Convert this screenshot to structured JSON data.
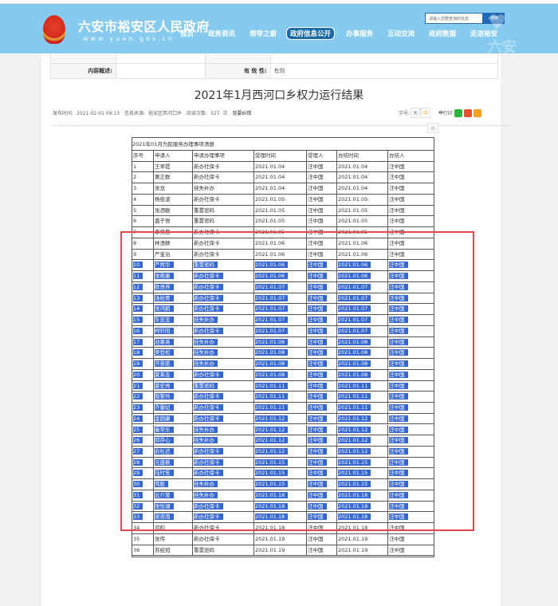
{
  "header": {
    "site_title": "六安市裕安区人民政府",
    "site_url": "www.yuan.gov.cn",
    "search_placeholder": "请输入您要查询的信息",
    "search_button": "搜索",
    "deco_text": "六安",
    "nav": [
      "首页",
      "政务资讯",
      "领导之窗",
      "政府信息公开",
      "办事服务",
      "互动交流",
      "政府数据",
      "走进裕安"
    ],
    "active_nav": 3
  },
  "meta": {
    "content_label": "内容概述:",
    "validity_label": "有 效 性:",
    "validity_value": "有效"
  },
  "article": {
    "title": "2021年1月西河口乡权力运行结果",
    "publish_label": "发布时间:",
    "publish_time": "2021-02-01 09:13",
    "source_label": "信息来源:",
    "source": "裕安区西河口乡",
    "views_label": "阅读次数:",
    "views": "327",
    "views_unit": "次",
    "correction": "我要纠错",
    "font_label": "字号:",
    "font_large": "大",
    "font_medium": "中",
    "font_small": "小",
    "print": "打印"
  },
  "table": {
    "caption": "2021年01月为民服务办理事项清册",
    "headers": [
      "序号",
      "申请人",
      "申请办理事项",
      "受理时间",
      "受理人",
      "办结时间",
      "办结人"
    ],
    "highlighted_rows": [
      10,
      33
    ],
    "rows": [
      [
        "1",
        "王翠提",
        "新办社保卡",
        "2021.01.04",
        "汪中国",
        "2021.01.04",
        "汪中国"
      ],
      [
        "2",
        "黄正群",
        "新办社保卡",
        "2021.01.04",
        "汪中国",
        "2021.01.04",
        "汪中国"
      ],
      [
        "3",
        "张龙",
        "挂失补办",
        "2021.01.04",
        "汪中国",
        "2021.01.04",
        "汪中国"
      ],
      [
        "4",
        "杨俊波",
        "新办社保卡",
        "2021.01.05",
        "汪中国",
        "2021.01.05",
        "汪中国"
      ],
      [
        "5",
        "张洒敏",
        "重置密码",
        "2021.01.05",
        "汪中国",
        "2021.01.05",
        "汪中国"
      ],
      [
        "6",
        "盛子悦",
        "重置密码",
        "2021.01.05",
        "汪中国",
        "2021.01.05",
        "汪中国"
      ],
      [
        "7",
        "李奕晨",
        "新办社保卡",
        "2021.01.05",
        "汪中国",
        "2021.01.05",
        "汪中国"
      ],
      [
        "8",
        "林澄静",
        "新办社保卡",
        "2021.01.06",
        "汪中国",
        "2021.01.06",
        "汪中国"
      ],
      [
        "9",
        "严宝治",
        "新办社保卡",
        "2021.01.06",
        "汪中国",
        "2021.01.06",
        "汪中国"
      ],
      [
        "10",
        "严席华",
        "重置密码",
        "2021.01.06",
        "汪中国",
        "2021.01.06",
        "汪中国"
      ],
      [
        "11",
        "张殿康",
        "新办社保卡",
        "2021.01.06",
        "汪中国",
        "2021.01.06",
        "汪中国"
      ],
      [
        "12",
        "欧贤界",
        "新办社保卡",
        "2021.01.07",
        "汪中国",
        "2021.01.07",
        "汪中国"
      ],
      [
        "13",
        "汤始青",
        "新办社保卡",
        "2021.01.07",
        "汪中国",
        "2021.01.07",
        "汪中国"
      ],
      [
        "14",
        "张鸿鹤",
        "新办社保卡",
        "2021.01.07",
        "汪中国",
        "2021.01.07",
        "汪中国"
      ],
      [
        "15",
        "车亚忠",
        "挂失补办",
        "2021.01.07",
        "汪中国",
        "2021.01.07",
        "汪中国"
      ],
      [
        "16",
        "柯轩阳",
        "新办社保卡",
        "2021.01.07",
        "汪中国",
        "2021.01.07",
        "汪中国"
      ],
      [
        "17",
        "池慕英",
        "挂失补办",
        "2021.01.08",
        "汪中国",
        "2021.01.08",
        "汪中国"
      ],
      [
        "18",
        "吴登松",
        "挂失补办",
        "2021.01.08",
        "汪中国",
        "2021.01.08",
        "汪中国"
      ],
      [
        "19",
        "齐奋愿",
        "挂失补办",
        "2021.01.08",
        "汪中国",
        "2021.01.08",
        "汪中国"
      ],
      [
        "20",
        "夏莱志",
        "新办社保卡",
        "2021.01.08",
        "汪中国",
        "2021.01.08",
        "汪中国"
      ],
      [
        "21",
        "夏史亮",
        "重置密码",
        "2021.01.11",
        "汪中国",
        "2021.01.11",
        "汪中国"
      ],
      [
        "22",
        "殷黎共",
        "新办社保卡",
        "2021.01.11",
        "汪中国",
        "2021.01.11",
        "汪中国"
      ],
      [
        "23",
        "齐馨妃",
        "新办社保卡",
        "2021.01.11",
        "汪中国",
        "2021.01.11",
        "汪中国"
      ],
      [
        "24",
        "金园康",
        "新办社保卡",
        "2021.01.12",
        "汪中国",
        "2021.01.12",
        "汪中国"
      ],
      [
        "25",
        "秦常乐",
        "挂失补办",
        "2021.01.12",
        "汪中国",
        "2021.01.12",
        "汪中国"
      ],
      [
        "26",
        "邱存心",
        "挂失补办",
        "2021.01.12",
        "汪中国",
        "2021.01.12",
        "汪中国"
      ],
      [
        "27",
        "俞杜迟",
        "新办社保卡",
        "2021.01.12",
        "汪中国",
        "2021.01.12",
        "汪中国"
      ],
      [
        "28",
        "元盛枫",
        "新办社保卡",
        "2021.01.15",
        "汪中国",
        "2021.01.15",
        "汪中国"
      ],
      [
        "29",
        "陆时笙",
        "新办社保卡",
        "2021.01.15",
        "汪中国",
        "2021.01.15",
        "汪中国"
      ],
      [
        "30",
        "简胜",
        "挂失补办",
        "2021.01.15",
        "汪中国",
        "2021.01.15",
        "汪中国"
      ],
      [
        "31",
        "云介棠",
        "挂失补办",
        "2021.01.18",
        "汪中国",
        "2021.01.18",
        "汪中国"
      ],
      [
        "32",
        "张怡湖",
        "新办社保卡",
        "2021.01.18",
        "汪中国",
        "2021.01.18",
        "汪中国"
      ],
      [
        "33",
        "梁夜雨",
        "新办社保卡",
        "2021.01.18",
        "汪中国",
        "2021.01.18",
        "汪中国"
      ],
      [
        "34",
        "邓昀",
        "新办社保卡",
        "2021.01.18",
        "汪中国",
        "2021.01.18",
        "汪中国"
      ],
      [
        "35",
        "张伟",
        "新办社保卡",
        "2021.01.19",
        "汪中国",
        "2021.01.19",
        "汪中国"
      ],
      [
        "36",
        "苏经冠",
        "重置密码",
        "2021.01.19",
        "汪中国",
        "2021.01.19",
        "汪中国"
      ]
    ]
  },
  "colors": {
    "header_bg": "#86cbef",
    "highlight": "#3667d1",
    "annotation_box": "#e5474c"
  }
}
